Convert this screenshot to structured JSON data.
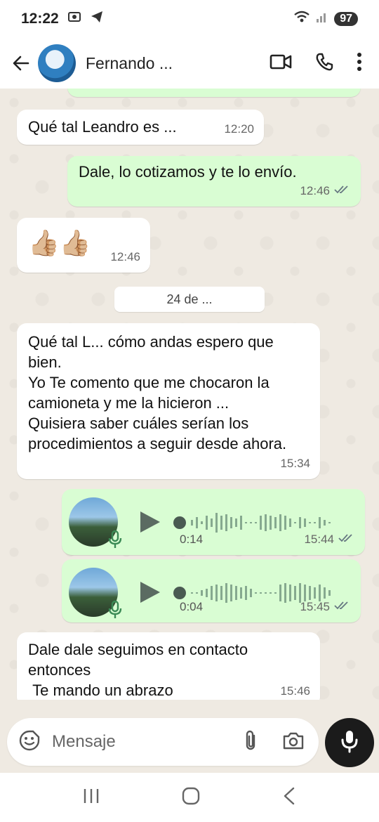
{
  "status_bar": {
    "time": "12:22",
    "battery": "97"
  },
  "header": {
    "contact_name": "Fernando ...",
    "icons": [
      "back-arrow-icon",
      "video-call-icon",
      "phone-icon",
      "more-vertical-icon"
    ]
  },
  "chat": {
    "messages": [
      {
        "dir": "in",
        "text": "Qué tal Leandro es ...",
        "time": "12:20"
      },
      {
        "dir": "out",
        "text": "Dale, lo cotizamos y te lo envío.",
        "time": "12:46"
      },
      {
        "dir": "in",
        "text": "👍🏼👍🏼",
        "time": "12:46"
      },
      {
        "dir": "in",
        "text": "Qué tal L... cómo andas espero que bien.\nYo Te comento que me chocaron la camioneta y me la hicieron ...\nQuisiera saber cuáles serían los procedimientos a seguir desde ahora.",
        "time": "15:34"
      },
      {
        "dir": "out",
        "type": "voice",
        "duration": "0:14",
        "time": "15:44"
      },
      {
        "dir": "out",
        "type": "voice",
        "duration": "0:04",
        "time": "15:45"
      },
      {
        "dir": "in",
        "text": "Dale dale seguimos en contacto entonces\n Te mando un abrazo",
        "time": "15:46"
      }
    ],
    "date_separator": "24 de ..."
  },
  "composer": {
    "placeholder": "Mensaje",
    "icons": [
      "emoji-icon",
      "attach-icon",
      "camera-icon",
      "mic-icon"
    ]
  },
  "nav": {
    "icons": [
      "recent-apps-icon",
      "home-icon",
      "back-icon"
    ]
  },
  "colors": {
    "outgoing_bubble": "#d9fdd3",
    "incoming_bubble": "#ffffff",
    "chat_background": "#efeae2"
  }
}
